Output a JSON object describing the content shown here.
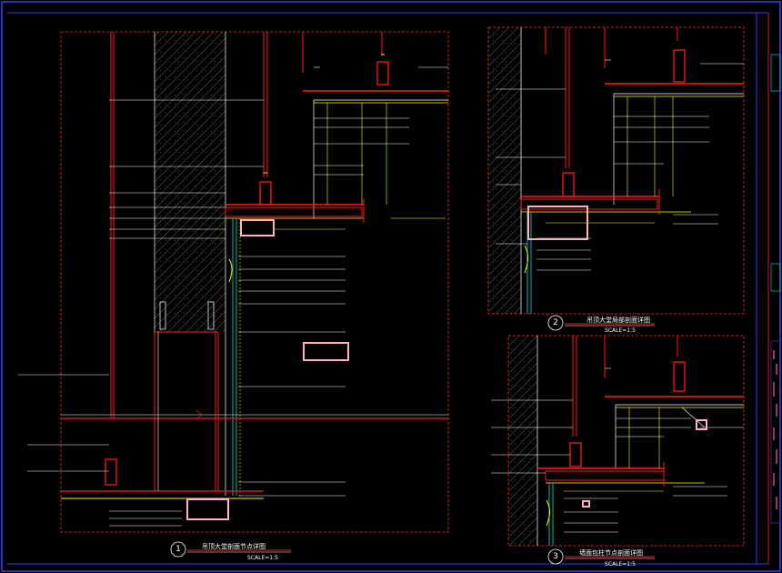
{
  "colors": {
    "background": "#000000",
    "frame": "#3a3aff",
    "viewport_border": "#ff2a2a",
    "primary_lines": "#ff1a1a",
    "leader_lines": "#ffffff",
    "dim_lines": "#ffff00",
    "panel": "#00e5e5",
    "highlight_box": "#ffb3c0",
    "wall_hatch": "#6a6a6a"
  },
  "views": [
    {
      "number": "1",
      "title": "吊顶大堂剖面节点详图",
      "scale": "SCALE=1:5"
    },
    {
      "number": "2",
      "title": "吊顶大堂局部剖面详图",
      "scale": "SCALE=1:5"
    },
    {
      "number": "3",
      "title": "墙面包柱节点剖面详图",
      "scale": "SCALE=1:5"
    }
  ]
}
